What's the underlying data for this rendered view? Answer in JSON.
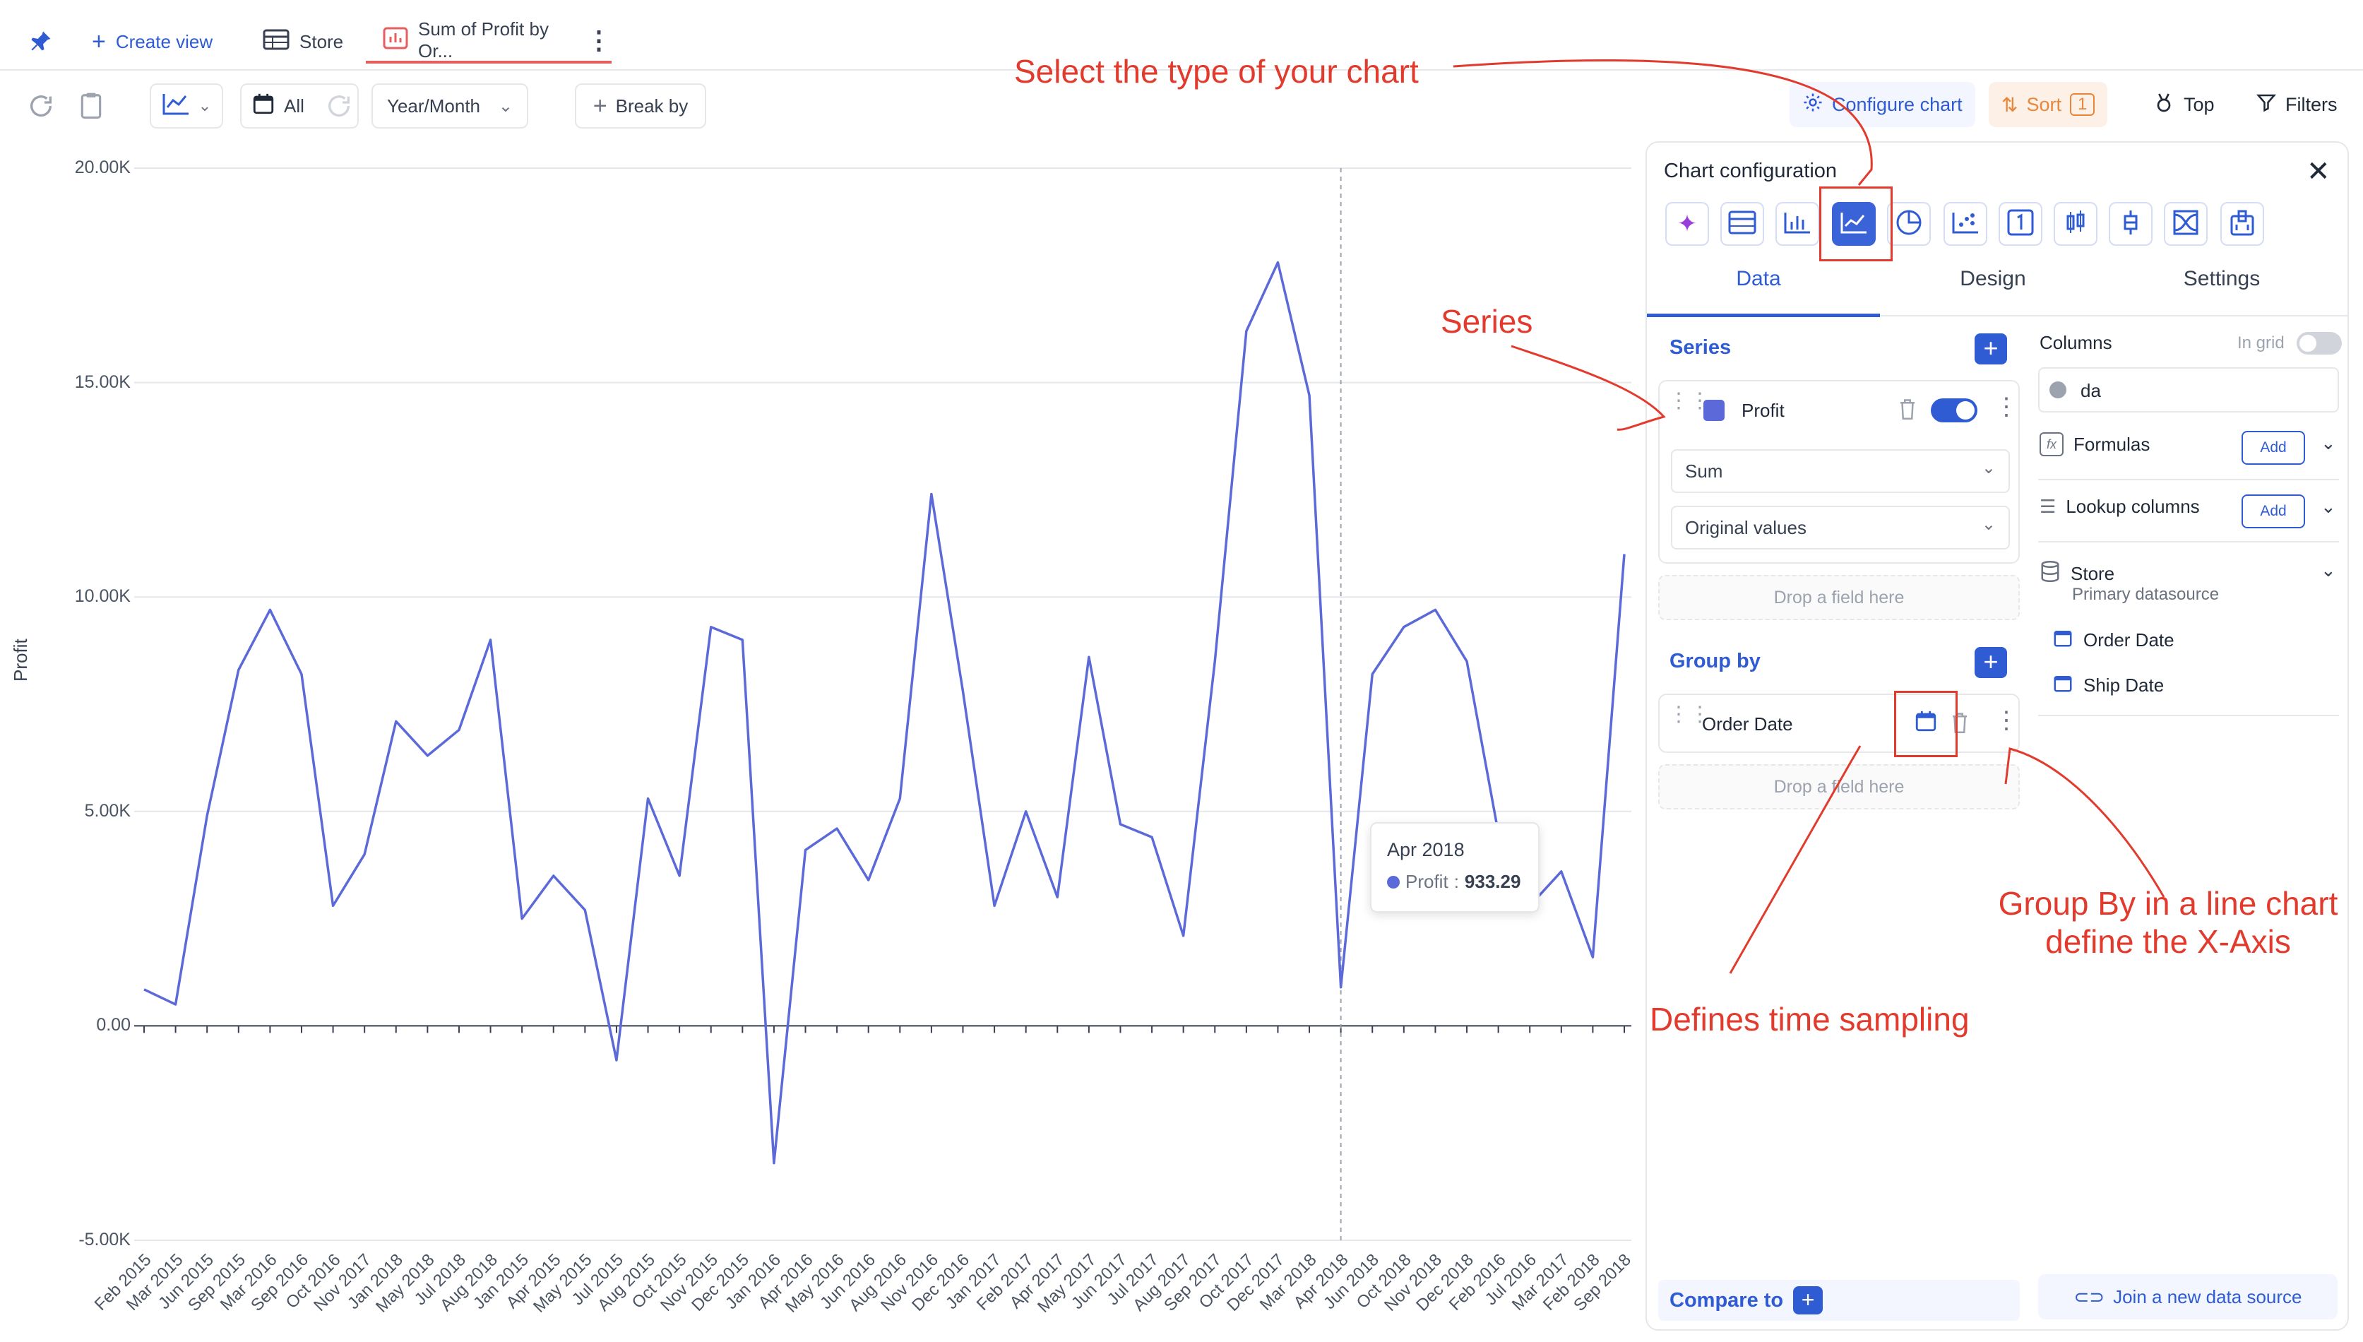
{
  "tabs": {
    "create_view": "Create view",
    "store": "Store",
    "chart_tab": "Sum of Profit by Or..."
  },
  "toolbar": {
    "date_filter": "All",
    "granularity": "Year/Month",
    "break_by": "Break by",
    "configure_chart": "Configure chart",
    "sort": "Sort",
    "sort_count": "1",
    "top": "Top",
    "filters": "Filters"
  },
  "chart_data": {
    "type": "line",
    "ylabel": "Profit",
    "ylim": [
      -5000,
      20000
    ],
    "yticks": [
      "20.00K",
      "15.00K",
      "10.00K",
      "5.00K",
      "0.00",
      "-5.00K"
    ],
    "ytick_values": [
      20000,
      15000,
      10000,
      5000,
      0,
      -5000
    ],
    "categories": [
      "Feb 2015",
      "Mar 2015",
      "Jun 2015",
      "Sep 2015",
      "Mar 2016",
      "Sep 2016",
      "Oct 2016",
      "Nov 2017",
      "Jan 2018",
      "May 2018",
      "Jul 2018",
      "Aug 2018",
      "Jan 2015",
      "Apr 2015",
      "May 2015",
      "Jul 2015",
      "Aug 2015",
      "Oct 2015",
      "Nov 2015",
      "Dec 2015",
      "Jan 2016",
      "Apr 2016",
      "May 2016",
      "Jun 2016",
      "Aug 2016",
      "Nov 2016",
      "Dec 2016",
      "Jan 2017",
      "Feb 2017",
      "Apr 2017",
      "May 2017",
      "Jun 2017",
      "Jul 2017",
      "Aug 2017",
      "Sep 2017",
      "Oct 2017",
      "Dec 2017",
      "Mar 2018",
      "Apr 2018",
      "Jun 2018",
      "Oct 2018",
      "Nov 2018",
      "Dec 2018",
      "Feb 2016",
      "Jul 2016",
      "Mar 2017",
      "Feb 2018",
      "Sep 2018"
    ],
    "series": [
      {
        "name": "Profit",
        "color": "#5b6ad8",
        "values": [
          850,
          500,
          4900,
          8300,
          9700,
          8200,
          2800,
          4000,
          7100,
          6300,
          6900,
          9000,
          2500,
          3500,
          2700,
          -800,
          5300,
          3500,
          9300,
          9000,
          -3200,
          4100,
          4600,
          3400,
          5300,
          12400,
          7800,
          2800,
          5000,
          3000,
          8600,
          4700,
          4400,
          2100,
          8500,
          16200,
          17800,
          14700,
          900,
          8200,
          9300,
          9700,
          8500,
          4500,
          2800,
          3600,
          1600,
          11000
        ]
      }
    ],
    "hover_index": 38,
    "tooltip": {
      "label": "Apr 2018",
      "series": "Profit",
      "value": "933.29"
    }
  },
  "config": {
    "title": "Chart configuration",
    "tabs": [
      "Data",
      "Design",
      "Settings"
    ],
    "series_label": "Series",
    "series_item": "Profit",
    "aggregation": "Sum",
    "values_mode": "Original values",
    "drop_placeholder": "Drop a field here",
    "group_by_label": "Group by",
    "group_by_item": "Order Date",
    "columns_label": "Columns",
    "in_grid": "In grid",
    "search_value": "da",
    "formulas": "Formulas",
    "lookup_columns": "Lookup columns",
    "add": "Add",
    "datasource_name": "Store",
    "datasource_sub": "Primary datasource",
    "date_fields": [
      "Order Date",
      "Ship Date"
    ],
    "compare_to": "Compare to",
    "join_source": "Join a new data source"
  },
  "annotations": {
    "chart_type": "Select the type of your chart",
    "series": "Series",
    "time_sampling": "Defines time sampling",
    "group_by_line1": "Group By in a line chart",
    "group_by_line2": "define the X-Axis"
  }
}
